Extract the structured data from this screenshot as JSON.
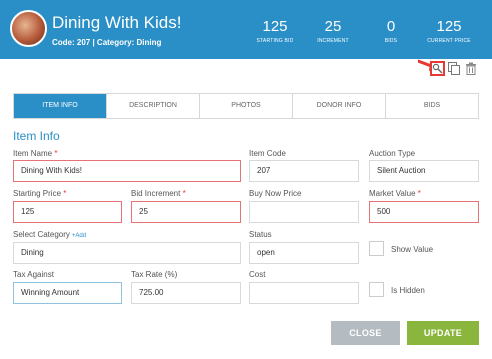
{
  "item": {
    "title": "Dining With Kids!",
    "subtitle": "Code: 207 | Category: Dining"
  },
  "stats": [
    {
      "value": "125",
      "label": "STARTING BID"
    },
    {
      "value": "25",
      "label": "INCREMENT"
    },
    {
      "value": "0",
      "label": "BIDS"
    },
    {
      "value": "125",
      "label": "CURRENT PRICE"
    }
  ],
  "tabs": [
    {
      "label": "ITEM INFO",
      "active": true
    },
    {
      "label": "DESCRIPTION",
      "active": false
    },
    {
      "label": "PHOTOS",
      "active": false
    },
    {
      "label": "DONOR INFO",
      "active": false
    },
    {
      "label": "BIDS",
      "active": false
    }
  ],
  "section_title": "Item Info",
  "form": {
    "item_name": {
      "label": "Item Name",
      "required": "*",
      "value": "Dining With Kids!"
    },
    "item_code": {
      "label": "Item Code",
      "value": "207"
    },
    "auction_type": {
      "label": "Auction Type",
      "value": "Silent Auction"
    },
    "starting_price": {
      "label": "Starting Price",
      "required": "*",
      "value": "125"
    },
    "bid_increment": {
      "label": "Bid Increment",
      "required": "*",
      "value": "25"
    },
    "buy_now_price": {
      "label": "Buy Now Price",
      "value": ""
    },
    "market_value": {
      "label": "Market Value",
      "required": "*",
      "value": "500"
    },
    "select_category": {
      "label": "Select Category",
      "add_label": "+Add",
      "value": "Dining"
    },
    "status": {
      "label": "Status",
      "value": "open"
    },
    "show_value": {
      "label": "Show Value",
      "checked": false
    },
    "tax_against": {
      "label": "Tax Against",
      "value": "Winning Amount"
    },
    "tax_rate": {
      "label": "Tax Rate (%)",
      "value": "725.00"
    },
    "cost": {
      "label": "Cost",
      "value": ""
    },
    "is_hidden": {
      "label": "Is Hidden",
      "checked": false
    }
  },
  "buttons": {
    "close": "CLOSE",
    "update": "UPDATE"
  },
  "colors": {
    "header": "#2a8fc7",
    "accent": "#2a8fc7",
    "error": "#e53935",
    "update": "#8bb63d",
    "close": "#b4bcc2"
  },
  "icons": {
    "toolbar": [
      "edit-icon",
      "copy-icon",
      "trash-icon"
    ],
    "annotation": "arrow-icon"
  }
}
